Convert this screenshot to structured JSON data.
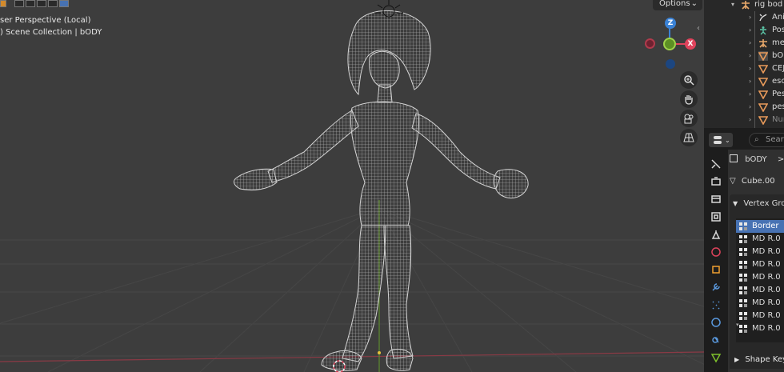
{
  "viewport": {
    "perspective_label": "ser Perspective (Local)",
    "collection_label": ") Scene Collection | bODY",
    "options_label": "Options",
    "options_chevron": "⌄",
    "gizmo": {
      "z": "Z",
      "x": "X"
    },
    "nav_icons": [
      "zoom-icon",
      "hand-pan-icon",
      "camera-icon",
      "grid-perspective-icon"
    ]
  },
  "outliner": {
    "items": [
      {
        "label": "rig bod",
        "icon": "armature-icon",
        "expanded": true
      },
      {
        "label": "Ani",
        "icon": "action-icon"
      },
      {
        "label": "Pos",
        "icon": "pose-icon"
      },
      {
        "label": "met",
        "icon": "armature-icon"
      },
      {
        "label": "bOD",
        "icon": "mesh-icon",
        "selected": true
      },
      {
        "label": "CEJ",
        "icon": "mesh-icon"
      },
      {
        "label": "esc",
        "icon": "mesh-icon"
      },
      {
        "label": "Pes",
        "icon": "mesh-icon"
      },
      {
        "label": "pes",
        "icon": "mesh-icon"
      },
      {
        "label": "Nur",
        "icon": "mesh-icon",
        "dimmed": true
      }
    ]
  },
  "properties": {
    "search_placeholder": "Sear",
    "object_name": "bODY",
    "breadcrumb_arrow": ">",
    "mesh_name": "Cube.00",
    "vertex_groups_label": "Vertex Grou",
    "vertex_groups": [
      {
        "label": "Border",
        "selected": true
      },
      {
        "label": "MD R.0"
      },
      {
        "label": "MD R.0"
      },
      {
        "label": "MD R.0"
      },
      {
        "label": "MD R.0"
      },
      {
        "label": "MD R.0"
      },
      {
        "label": "MD R.0"
      },
      {
        "label": "MD R.0"
      },
      {
        "label": "MD R.0"
      }
    ],
    "shape_keys_label": "Shape Keys",
    "tabs": [
      "tool-icon",
      "render-icon",
      "output-icon",
      "view-layer-icon",
      "scene-icon",
      "world-icon",
      "object-icon",
      "modifier-icon",
      "particles-icon",
      "physics-icon",
      "constraints-icon",
      "data-icon"
    ]
  },
  "colors": {
    "accent": "#4772b3",
    "axis_x": "#e0435c",
    "axis_y": "#7ec02c",
    "axis_z": "#3a82d6",
    "wire": "#c8c8c8"
  }
}
